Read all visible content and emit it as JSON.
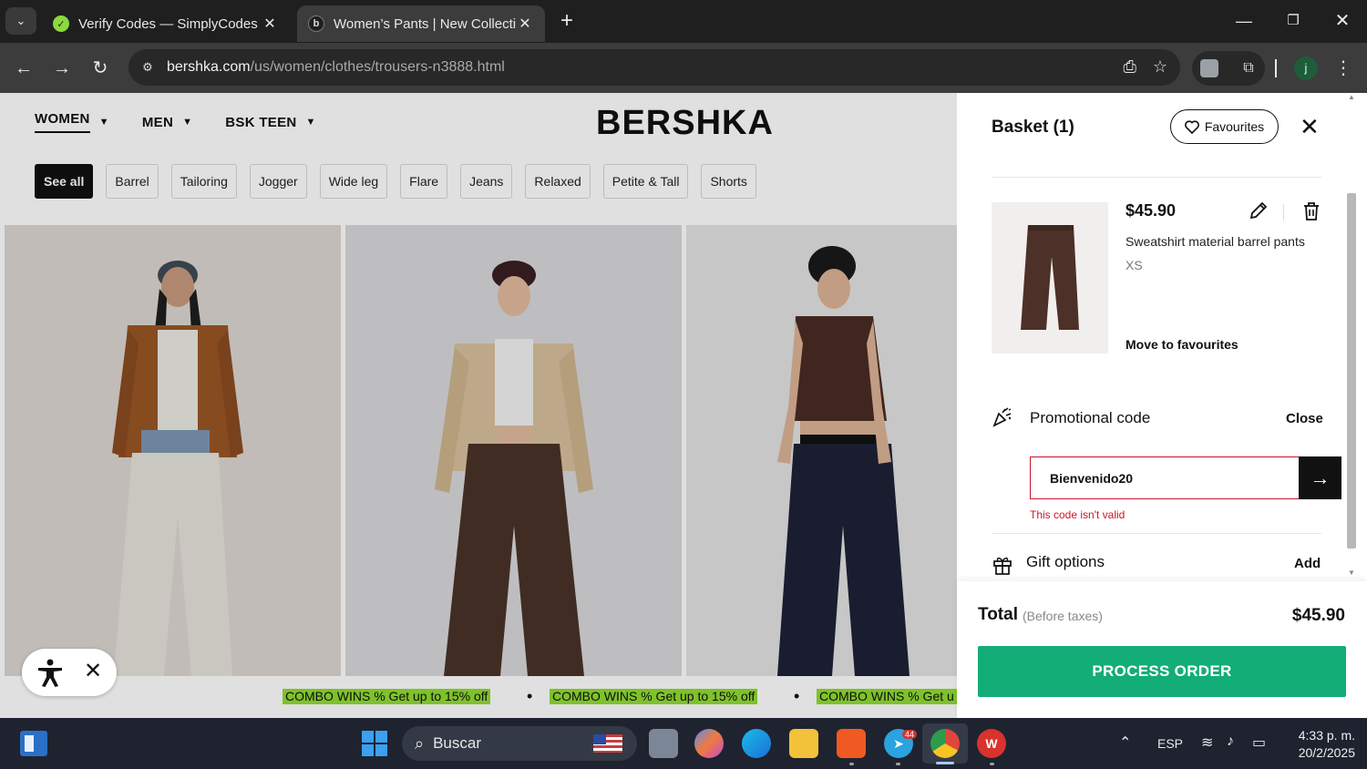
{
  "browser": {
    "tabs": [
      {
        "title": "Verify Codes — SimplyCodes",
        "favicon": "simplycodes-icon"
      },
      {
        "title": "Women’s Pants | New Collection",
        "favicon": "bershka-icon"
      }
    ],
    "url_host": "bershka.com",
    "url_path": "/us/women/clothes/trousers-n3888.html",
    "profile_initial": "j"
  },
  "site": {
    "logo": "BERSHKA",
    "nav": [
      "WOMEN",
      "MEN",
      "BSK TEEN"
    ],
    "filters": [
      "See all",
      "Barrel",
      "Tailoring",
      "Jogger",
      "Wide leg",
      "Flare",
      "Jeans",
      "Relaxed",
      "Petite & Tall",
      "Shorts"
    ],
    "promo_strip": [
      "COMBO WINS % Get up to 15% off",
      "COMBO WINS % Get up to 15% off",
      "COMBO WINS % Get u"
    ],
    "promo_highlight": "#90dd30"
  },
  "basket": {
    "title": "Basket (1)",
    "favourites_label": "Favourites",
    "item": {
      "price": "$45.90",
      "name": "Sweatshirt material barrel pants",
      "size": "XS",
      "move_to_favourites": "Move to favourites"
    },
    "promo": {
      "label": "Promotional code",
      "close_label": "Close",
      "code_value": "Bienvenido20",
      "error": "This code isn't valid"
    },
    "gift": {
      "label": "Gift options",
      "add_label": "Add"
    },
    "total_label": "Total",
    "total_note": "(Before taxes)",
    "total_value": "$45.90",
    "process_label": "PROCESS ORDER",
    "accent": "#13ad78",
    "error_color": "#c9172b"
  },
  "taskbar": {
    "search_placeholder": "Buscar",
    "telegram_badge": "44",
    "language": "ESP",
    "time": "4:33 p. m.",
    "date": "20/2/2025"
  }
}
